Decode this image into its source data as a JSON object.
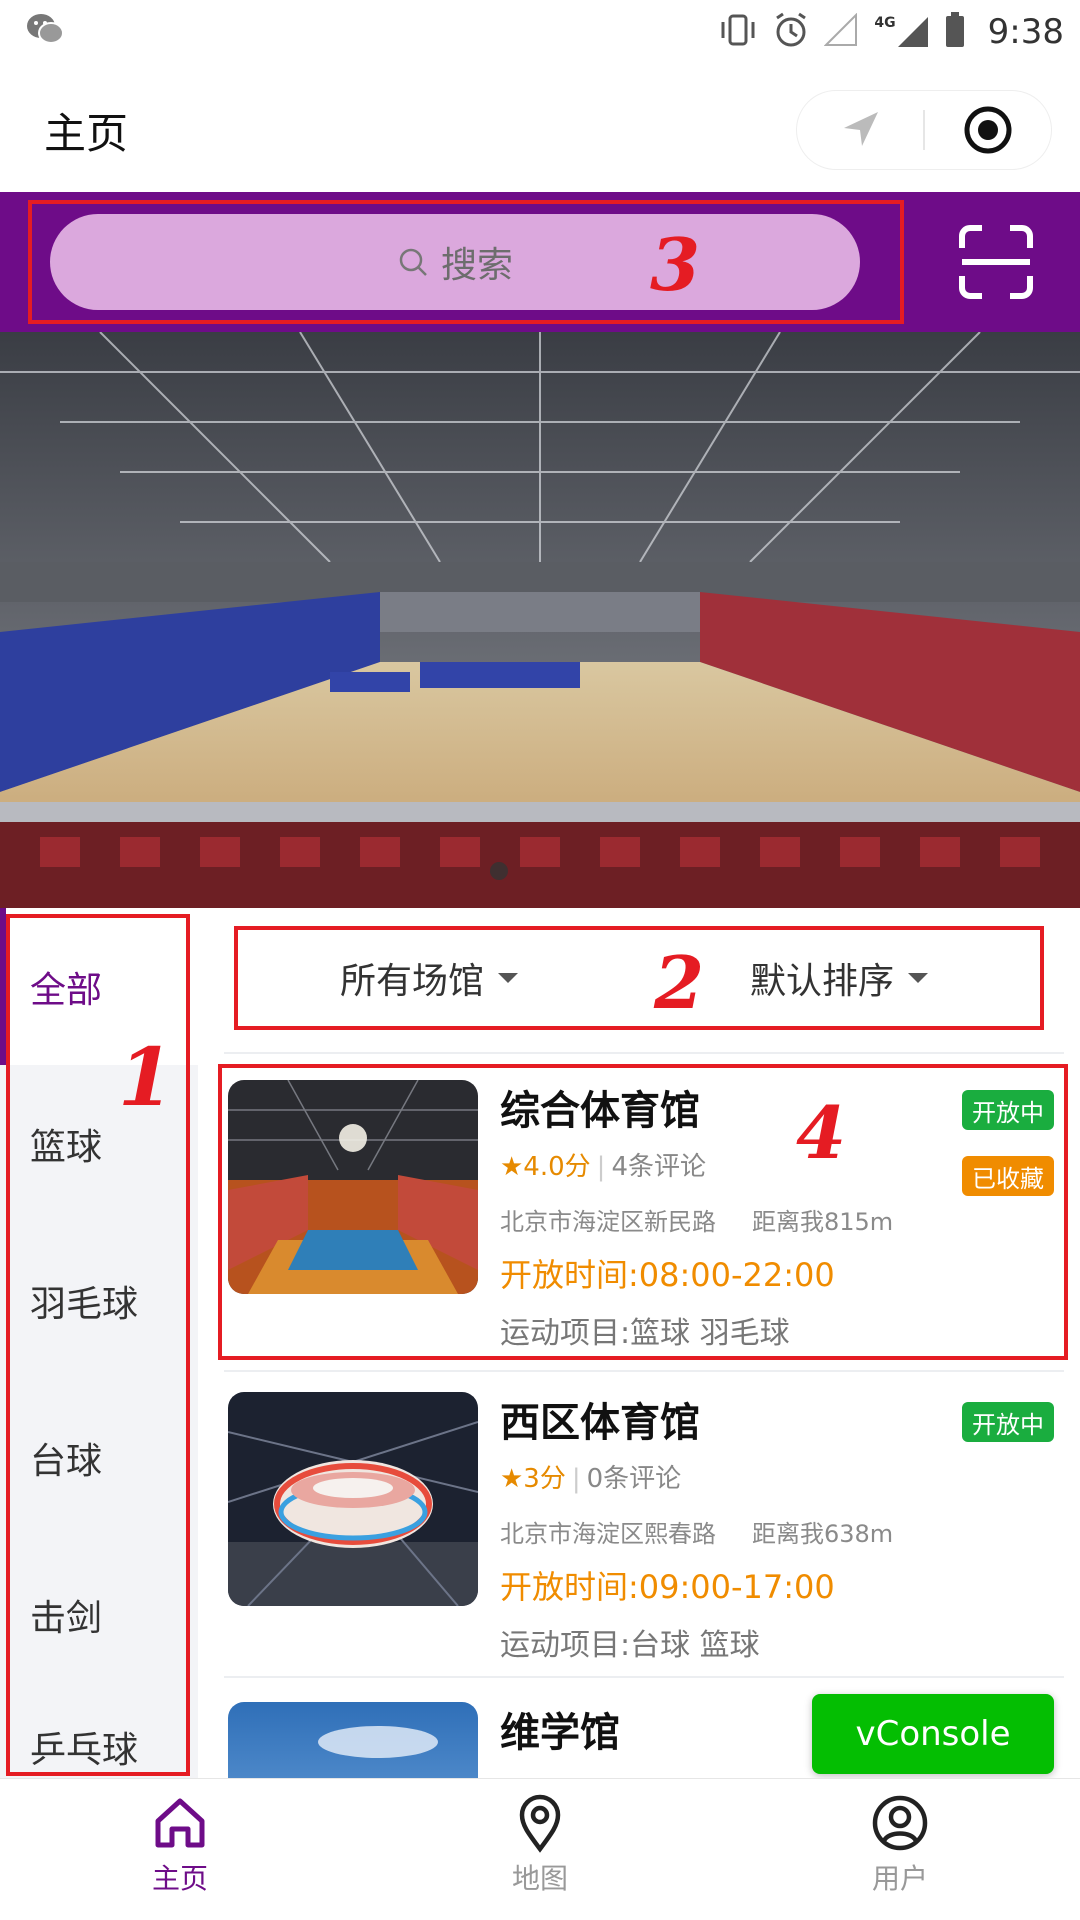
{
  "status_bar": {
    "time": "9:38",
    "network": "4G"
  },
  "header": {
    "title": "主页"
  },
  "search": {
    "placeholder": "搜索"
  },
  "annotations": {
    "sidebar": "1",
    "filters": "2",
    "search": "3",
    "card": "4"
  },
  "sidebar": {
    "items": [
      {
        "label": "全部",
        "active": true
      },
      {
        "label": "篮球"
      },
      {
        "label": "羽毛球"
      },
      {
        "label": "台球"
      },
      {
        "label": "击剑"
      },
      {
        "label": "乒乓球"
      }
    ]
  },
  "filters": {
    "venue": "所有场馆",
    "sort": "默认排序"
  },
  "venues": [
    {
      "name": "综合体育馆",
      "rating": "★4.0分",
      "reviews": "4条评论",
      "address": "北京市海淀区新民路",
      "distance": "距离我815m",
      "hours": "开放时间:08:00-22:00",
      "sports": "运动项目:篮球 羽毛球",
      "status": "开放中",
      "favorite": "已收藏"
    },
    {
      "name": "西区体育馆",
      "rating": "★3分",
      "reviews": "0条评论",
      "address": "北京市海淀区熙春路",
      "distance": "距离我638m",
      "hours": "开放时间:09:00-17:00",
      "sports": "运动项目:台球 篮球",
      "status": "开放中"
    },
    {
      "name": "维学馆"
    }
  ],
  "vconsole": "vConsole",
  "tabs": [
    {
      "label": "主页",
      "icon": "home-icon",
      "active": true
    },
    {
      "label": "地图",
      "icon": "map-pin-icon"
    },
    {
      "label": "用户",
      "icon": "user-icon"
    }
  ],
  "colors": {
    "brand": "#6e0c88",
    "open": "#1aad3f",
    "accent": "#f08c00",
    "annotation": "#e51c23"
  }
}
